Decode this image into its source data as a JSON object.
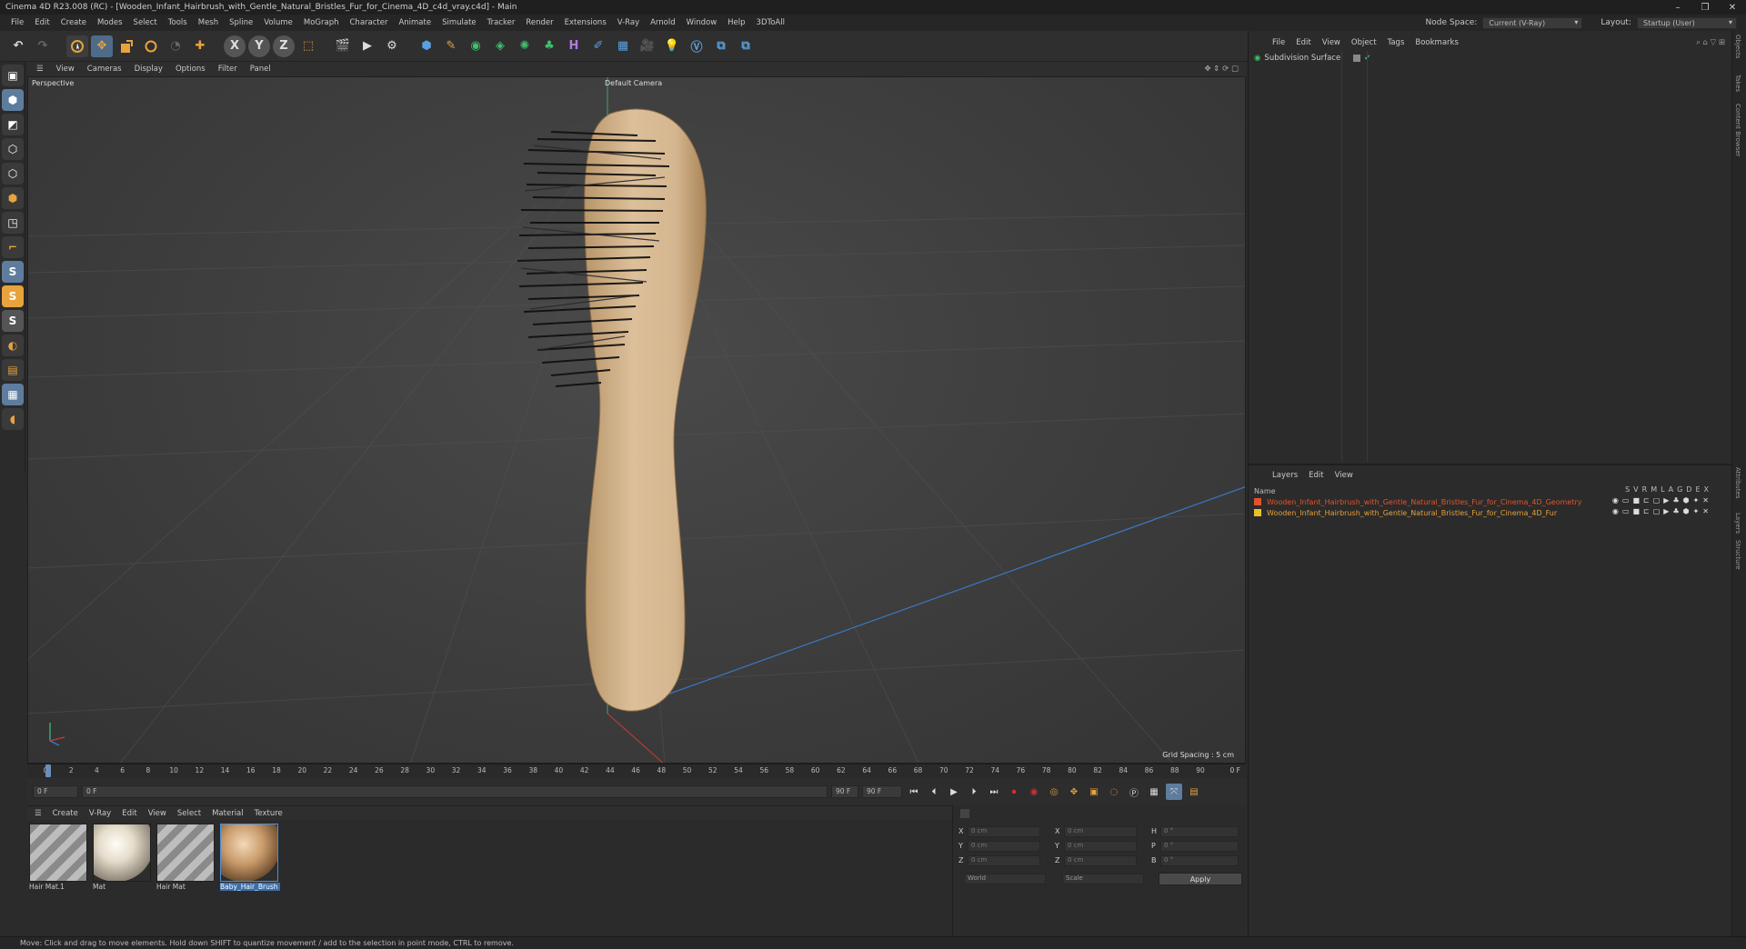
{
  "window": {
    "title": "Cinema 4D R23.008 (RC) - [Wooden_Infant_Hairbrush_with_Gentle_Natural_Bristles_Fur_for_Cinema_4D_c4d_vray.c4d] - Main",
    "controls": [
      "–",
      "❐",
      "✕"
    ]
  },
  "menubar": {
    "items": [
      "File",
      "Edit",
      "Create",
      "Modes",
      "Select",
      "Tools",
      "Mesh",
      "Spline",
      "Volume",
      "MoGraph",
      "Character",
      "Animate",
      "Simulate",
      "Tracker",
      "Render",
      "Extensions",
      "V-Ray",
      "Arnold",
      "Window",
      "Help",
      "3DToAll"
    ],
    "node_space_label": "Node Space:",
    "node_space_value": "Current (V-Ray)",
    "layout_label": "Layout:",
    "layout_value": "Startup (User)"
  },
  "toolbar": {
    "axis_x": "X",
    "axis_y": "Y",
    "axis_z": "Z"
  },
  "viewport": {
    "menu": [
      "View",
      "Cameras",
      "Display",
      "Options",
      "Filter",
      "Panel"
    ],
    "projection": "Perspective",
    "camera": "Default Camera",
    "grid_spacing": "Grid Spacing : 5 cm"
  },
  "timeline": {
    "ticks": [
      "0",
      "2",
      "4",
      "6",
      "8",
      "10",
      "12",
      "14",
      "16",
      "18",
      "20",
      "22",
      "24",
      "26",
      "28",
      "30",
      "32",
      "34",
      "36",
      "38",
      "40",
      "42",
      "44",
      "46",
      "48",
      "50",
      "52",
      "54",
      "56",
      "58",
      "60",
      "62",
      "64",
      "66",
      "68",
      "70",
      "72",
      "74",
      "76",
      "78",
      "80",
      "82",
      "84",
      "86",
      "88",
      "90"
    ],
    "end_frame_label": "0 F",
    "current_frame": "0 F",
    "start_field": "0 F",
    "end_field": "90 F",
    "end_field2": "90 F"
  },
  "materials": {
    "menu": [
      "Create",
      "V-Ray",
      "Edit",
      "View",
      "Select",
      "Material",
      "Texture"
    ],
    "items": [
      {
        "name": "Hair Mat.1",
        "kind": "hair"
      },
      {
        "name": "Mat",
        "kind": "white"
      },
      {
        "name": "Hair Mat",
        "kind": "hair"
      },
      {
        "name": "Baby_Hair_Brush",
        "kind": "wood"
      }
    ]
  },
  "coordinates": {
    "rows": [
      {
        "axis": "X",
        "pos": "0 cm",
        "axis2": "X",
        "size": "0 cm",
        "axis3": "H",
        "rot": "0 °"
      },
      {
        "axis": "Y",
        "pos": "0 cm",
        "axis2": "Y",
        "size": "0 cm",
        "axis3": "P",
        "rot": "0 °"
      },
      {
        "axis": "Z",
        "pos": "0 cm",
        "axis2": "Z",
        "size": "0 cm",
        "axis3": "B",
        "rot": "0 °"
      }
    ],
    "mode1": "World",
    "mode2": "Scale",
    "apply": "Apply"
  },
  "objects_panel": {
    "menu": [
      "File",
      "Edit",
      "View",
      "Object",
      "Tags",
      "Bookmarks"
    ],
    "object": "Subdivision Surface"
  },
  "layers_panel": {
    "menu": [
      "Layers",
      "Edit",
      "View"
    ],
    "header_name": "Name",
    "header_flags": [
      "S",
      "V",
      "R",
      "M",
      "L",
      "A",
      "G",
      "D",
      "E",
      "X"
    ],
    "layers": [
      {
        "name": "Wooden_Infant_Hairbrush_with_Gentle_Natural_Bristles_Fur_for_Cinema_4D_Geometry",
        "color": "#e0542a"
      },
      {
        "name": "Wooden_Infant_Hairbrush_with_Gentle_Natural_Bristles_Fur_for_Cinema_4D_Fur",
        "color": "#e6c32a"
      }
    ]
  },
  "side_tabs": [
    "Objects",
    "Takes",
    "Content Browser",
    "Attributes",
    "Layers",
    "Structure"
  ],
  "status": "Move: Click and drag to move elements. Hold down SHIFT to quantize movement / add to the selection in point mode, CTRL to remove.",
  "colors": {
    "accent": "#4a90d9",
    "layer_orange": "#e0542a",
    "layer_yellow": "#e6c32a"
  }
}
